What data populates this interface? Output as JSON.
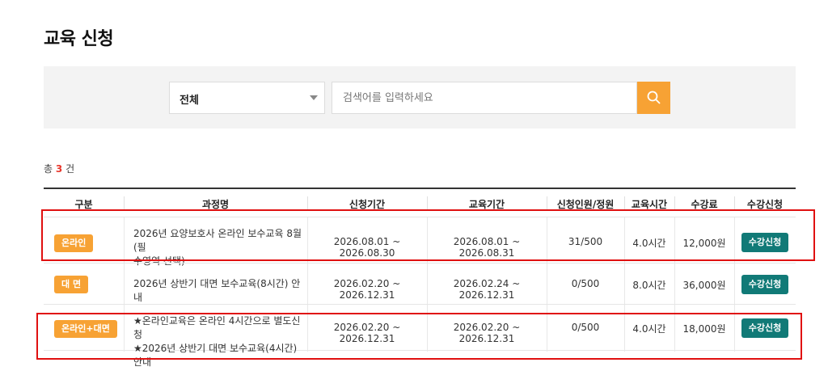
{
  "page": {
    "title": "교육 신청"
  },
  "search": {
    "select_value": "전체",
    "placeholder": "검색어를 입력하세요"
  },
  "summary": {
    "prefix": "총",
    "count": "3",
    "suffix": "건"
  },
  "table": {
    "headers": [
      "구분",
      "과정명",
      "신청기간",
      "교육기간",
      "신청인원/정원",
      "교육시간",
      "수강료",
      "수강신청"
    ],
    "rows": [
      {
        "category": "온라인",
        "course_line1": "2026년 요양보호사 온라인 보수교육 8월 (필",
        "course_line2": "수영역 선택)",
        "apply_period": "2026.08.01 ~ 2026.08.30",
        "edu_period": "2026.08.01 ~ 2026.08.31",
        "enrollment": "31/500",
        "hours": "4.0시간",
        "fee": "12,000원",
        "action": "수강신청"
      },
      {
        "category": "대 면",
        "course_line1": "2026년 상반기 대면 보수교육(8시간) 안내",
        "course_line2": "",
        "apply_period": "2026.02.20 ~ 2026.12.31",
        "edu_period": "2026.02.24 ~ 2026.12.31",
        "enrollment": "0/500",
        "hours": "8.0시간",
        "fee": "36,000원",
        "action": "수강신청"
      },
      {
        "category": "온라인+대면",
        "course_line1": "★온라인교육은 온라인 4시간으로 별도신청",
        "course_line2": "★2026년 상반기 대면 보수교육(4시간) 안내",
        "apply_period": "2026.02.20 ~ 2026.12.31",
        "edu_period": "2026.02.20 ~ 2026.12.31",
        "enrollment": "0/500",
        "hours": "4.0시간",
        "fee": "18,000원",
        "action": "수강신청"
      }
    ]
  },
  "colors": {
    "accent_orange": "#f7a234",
    "button_teal": "#117a77",
    "count_red": "#e8382d",
    "highlight_red": "#e01010"
  },
  "icons": {
    "search": "search-icon",
    "dropdown": "chevron-down-icon"
  }
}
